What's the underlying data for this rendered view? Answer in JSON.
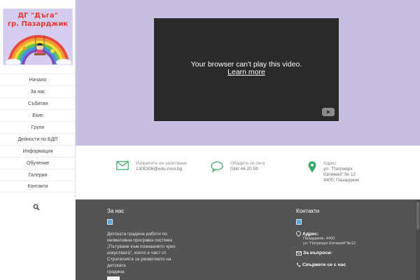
{
  "logo": {
    "line1": "ДГ \"Дъга\"",
    "line2": "гр. Пазарджик"
  },
  "nav": {
    "items": [
      {
        "label": "Начало"
      },
      {
        "label": "За нас"
      },
      {
        "label": "Събития"
      },
      {
        "label": "Екип"
      },
      {
        "label": "Групи"
      },
      {
        "label": "Дейности по БДП"
      },
      {
        "label": "Информация"
      },
      {
        "label": "Обучение"
      },
      {
        "label": "Галерия"
      },
      {
        "label": "Контакти"
      }
    ],
    "search_icon": "search-icon"
  },
  "video": {
    "message": "Your browser can't play this video.",
    "link": "Learn more",
    "icon": "youtube-icon"
  },
  "info": {
    "email": {
      "icon": "envelope-icon",
      "title": "Изпратете ни запитване",
      "value": "1305306@edu.mon.bg"
    },
    "phone": {
      "icon": "speech-bubble-icon",
      "title": "Обадете се сега",
      "value": "034/ 44 20 59"
    },
    "address": {
      "icon": "map-pin-icon",
      "title": "Адрес",
      "line1": "ул. \"Патриарх",
      "line2": "Евтимий\" № 12",
      "line3": "4400, Пазарджик"
    }
  },
  "footer": {
    "about": {
      "heading": "За нас",
      "para": [
        "Детската градина работи по",
        "иновативна програма система",
        "„Пътуване към познанието чрез",
        "изкуствата\", която е част от",
        "Стратегията за развитието на детската",
        "градина"
      ]
    },
    "contacts": {
      "heading": "Контакти",
      "address_label": "Адрес:",
      "address_line1": "Пазарджик, 4400",
      "address_line2": "ул.\"Патриарх Евтимий\"№12",
      "questions_label": "За въпроси:",
      "questions_value": "",
      "call_label": "Свържете се с нас"
    }
  },
  "colors": {
    "accent_green": "#3aa868",
    "video_band": "#c8bfe0",
    "footer_bg": "#545454"
  }
}
